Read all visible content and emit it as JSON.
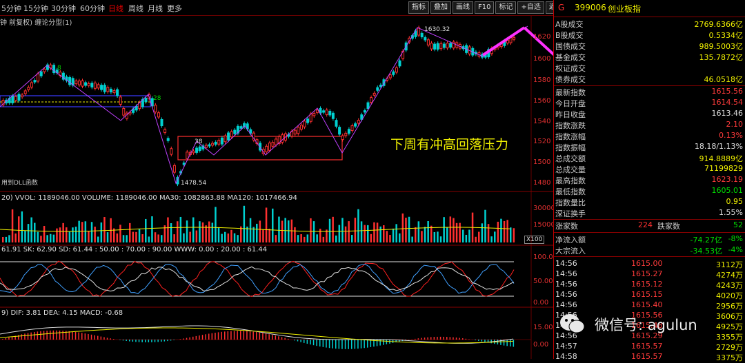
{
  "toolbar": {
    "timeframes": [
      "5分钟",
      "15分钟",
      "30分钟",
      "60分钟",
      "日线",
      "周线",
      "月线",
      "更多"
    ],
    "active_index": 4,
    "buttons": [
      "指标",
      "叠加",
      "画线",
      "F10",
      "标记",
      "+自选",
      "返回"
    ]
  },
  "subtitle": "钟 前复权) 缠论分型(1)",
  "price_axis": [
    "1620",
    "1600",
    "1580",
    "1560",
    "1540",
    "1520",
    "1500",
    "1480"
  ],
  "price_marks": {
    "high": "1630.32",
    "low": "1478.54",
    "left_tag": "8",
    "mid_tag": "28",
    "box_tag": "38",
    "note": "用到DLL函数"
  },
  "annotation": "下周有冲高回落压力",
  "volume": {
    "header": "20) VVOL: 1189046.00  VOLUME: 1189046.00  MA30: 1082863.88  MA120: 1017466.94",
    "axis": [
      "30000",
      "15000"
    ],
    "unit": "X100"
  },
  "kdj": {
    "header": "61.91  SK: 62.90  SD: 61.44  : 50.00  : 70.00  : 90.00  WWW: 0.00  : 20.00  : 61.44",
    "axis": [
      "100.0",
      "50.00",
      "0.00"
    ]
  },
  "macd": {
    "header": "9) DIF: 3.81  DEA: 4.15  MACD: -0.68",
    "axis": [
      "15.00",
      "0.00"
    ]
  },
  "quote": {
    "code": "399006",
    "name": "创业板指",
    "g": "G",
    "turnover": [
      {
        "k": "A股成交",
        "v": "2769.6366亿"
      },
      {
        "k": "B股成交",
        "v": "0.5334亿"
      },
      {
        "k": "国债成交",
        "v": "989.5003亿"
      },
      {
        "k": "基金成交",
        "v": "135.7872亿"
      },
      {
        "k": "权证成交",
        "v": ""
      },
      {
        "k": "债券成交",
        "v": "46.0518亿"
      }
    ],
    "stats": [
      {
        "k": "最新指数",
        "v": "1615.56",
        "c": "red"
      },
      {
        "k": "今日开盘",
        "v": "1614.54",
        "c": "red"
      },
      {
        "k": "昨日收盘",
        "v": "1613.46",
        "c": "wht"
      },
      {
        "k": "指数涨跌",
        "v": "2.10",
        "c": "red"
      },
      {
        "k": "指数涨幅",
        "v": "0.13%",
        "c": "red"
      },
      {
        "k": "指数振幅",
        "v": "18.18/1.13%",
        "c": "wht"
      },
      {
        "k": "总成交额",
        "v": "914.8889亿",
        "c": "yel"
      },
      {
        "k": "总成交量",
        "v": "71199829",
        "c": "yel"
      },
      {
        "k": "最高指数",
        "v": "1623.19",
        "c": "red"
      },
      {
        "k": "最低指数",
        "v": "1605.01",
        "c": "grn"
      },
      {
        "k": "指数量比",
        "v": "0.95",
        "c": "yel"
      },
      {
        "k": "深证换手",
        "v": "1.55%",
        "c": "wht"
      }
    ],
    "updown": {
      "up_label": "涨家数",
      "up": "224",
      "down_label": "跌家数",
      "down": "52"
    },
    "flows": [
      {
        "k": "净流入额",
        "v": "-74.27亿",
        "p": "-8%"
      },
      {
        "k": "大宗流入",
        "v": "-34.53亿",
        "p": "-4%"
      }
    ],
    "ticks": [
      {
        "t": "14:56",
        "p": "1615.00",
        "v": "3112万"
      },
      {
        "t": "14:56",
        "p": "1615.27",
        "v": "4274万"
      },
      {
        "t": "14:56",
        "p": "1615.12",
        "v": "4243万"
      },
      {
        "t": "14:56",
        "p": "1615.15",
        "v": "4020万"
      },
      {
        "t": "14:56",
        "p": "1615.40",
        "v": "2956万"
      },
      {
        "t": "14:56",
        "p": "1615.56",
        "v": "3606万"
      },
      {
        "t": "14:56",
        "p": "1615.48",
        "v": "4925万"
      },
      {
        "t": "14:56",
        "p": "1615.29",
        "v": "3355万"
      },
      {
        "t": "14:57",
        "p": "1615.57",
        "v": "2729万"
      },
      {
        "t": "14:58",
        "p": "1615.57",
        "v": "3375万"
      }
    ]
  },
  "watermark": "微信号: agulun"
}
